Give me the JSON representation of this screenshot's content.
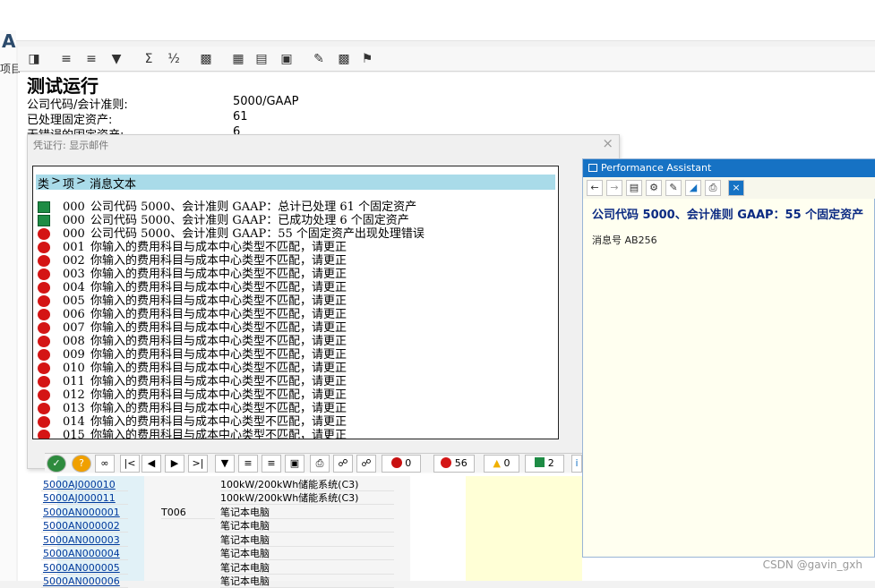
{
  "left": {
    "letter": "A",
    "sub": "项目"
  },
  "report": {
    "title": "测试运行",
    "fields": [
      {
        "label": "公司代码/会计准则:",
        "value": "5000/GAAP"
      },
      {
        "label": "已处理固定资产:",
        "value": "61"
      },
      {
        "label": "无错误的固定资产:",
        "value": "6"
      }
    ]
  },
  "dialog": {
    "title": "凭证行: 显示邮件",
    "header": {
      "type": "类",
      "item": "项",
      "text": "消息文本"
    },
    "rows": [
      {
        "status": "green",
        "no": "000",
        "text": "公司代码 5000、会计准则 GAAP：总计已处理 61 个固定资产"
      },
      {
        "status": "green",
        "no": "000",
        "text": "公司代码 5000、会计准则 GAAP：已成功处理 6 个固定资产"
      },
      {
        "status": "red",
        "no": "000",
        "text": "公司代码 5000、会计准则 GAAP：55 个固定资产出现处理错误"
      },
      {
        "status": "red",
        "no": "001",
        "text": "你输入的费用科目与成本中心类型不匹配，请更正"
      },
      {
        "status": "red",
        "no": "002",
        "text": "你输入的费用科目与成本中心类型不匹配，请更正"
      },
      {
        "status": "red",
        "no": "003",
        "text": "你输入的费用科目与成本中心类型不匹配，请更正"
      },
      {
        "status": "red",
        "no": "004",
        "text": "你输入的费用科目与成本中心类型不匹配，请更正"
      },
      {
        "status": "red",
        "no": "005",
        "text": "你输入的费用科目与成本中心类型不匹配，请更正"
      },
      {
        "status": "red",
        "no": "006",
        "text": "你输入的费用科目与成本中心类型不匹配，请更正"
      },
      {
        "status": "red",
        "no": "007",
        "text": "你输入的费用科目与成本中心类型不匹配，请更正"
      },
      {
        "status": "red",
        "no": "008",
        "text": "你输入的费用科目与成本中心类型不匹配，请更正"
      },
      {
        "status": "red",
        "no": "009",
        "text": "你输入的费用科目与成本中心类型不匹配，请更正"
      },
      {
        "status": "red",
        "no": "010",
        "text": "你输入的费用科目与成本中心类型不匹配，请更正"
      },
      {
        "status": "red",
        "no": "011",
        "text": "你输入的费用科目与成本中心类型不匹配，请更正"
      },
      {
        "status": "red",
        "no": "012",
        "text": "你输入的费用科目与成本中心类型不匹配，请更正"
      },
      {
        "status": "red",
        "no": "013",
        "text": "你输入的费用科目与成本中心类型不匹配，请更正"
      },
      {
        "status": "red",
        "no": "014",
        "text": "你输入的费用科目与成本中心类型不匹配，请更正"
      },
      {
        "status": "red",
        "no": "015",
        "text": "你输入的费用科目与成本中心类型不匹配，请更正"
      }
    ],
    "status_counts": {
      "stop": "0",
      "error": "56",
      "warning": "0",
      "success": "2"
    }
  },
  "table": {
    "rows": [
      {
        "key": "5000AJ000010",
        "code": "",
        "desc": "100kW/200kWh储能系统(C3)"
      },
      {
        "key": "5000AJ000011",
        "code": "",
        "desc": "100kW/200kWh储能系统(C3)"
      },
      {
        "key": "5000AN000001",
        "code": "T006",
        "desc": "笔记本电脑"
      },
      {
        "key": "5000AN000002",
        "code": "",
        "desc": "笔记本电脑"
      },
      {
        "key": "5000AN000003",
        "code": "",
        "desc": "笔记本电脑"
      },
      {
        "key": "5000AN000004",
        "code": "",
        "desc": "笔记本电脑"
      },
      {
        "key": "5000AN000005",
        "code": "",
        "desc": "笔记本电脑"
      },
      {
        "key": "5000AN000006",
        "code": "",
        "desc": "笔记本电脑"
      }
    ]
  },
  "assistant": {
    "title": "Performance Assistant",
    "heading": "公司代码 5000、会计准则 GAAP：55 个固定资产",
    "message_no": "消息号 AB256"
  },
  "watermark": "CSDN @gavin_gxh",
  "colors": {
    "accent": "#1672c4",
    "error": "#d41515",
    "success": "#1e8c45",
    "header": "#a9dbe9"
  }
}
